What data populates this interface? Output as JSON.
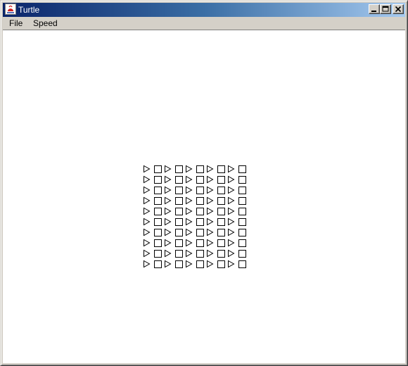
{
  "window": {
    "title": "Turtle",
    "title_bar_colors": {
      "start": "#0a246a",
      "end": "#a6caf0"
    },
    "buttons": {
      "minimize_icon": "minimize-icon",
      "maximize_icon": "maximize-icon",
      "close_icon": "close-icon"
    }
  },
  "menu": {
    "items": [
      {
        "label": "File"
      },
      {
        "label": "Speed"
      }
    ]
  },
  "canvas": {
    "background": "#ffffff",
    "grid": {
      "rows": 10,
      "columns": 5
    },
    "shapes": {
      "pattern": [
        "triangle-right",
        "square"
      ],
      "stroke": "#000000"
    }
  }
}
